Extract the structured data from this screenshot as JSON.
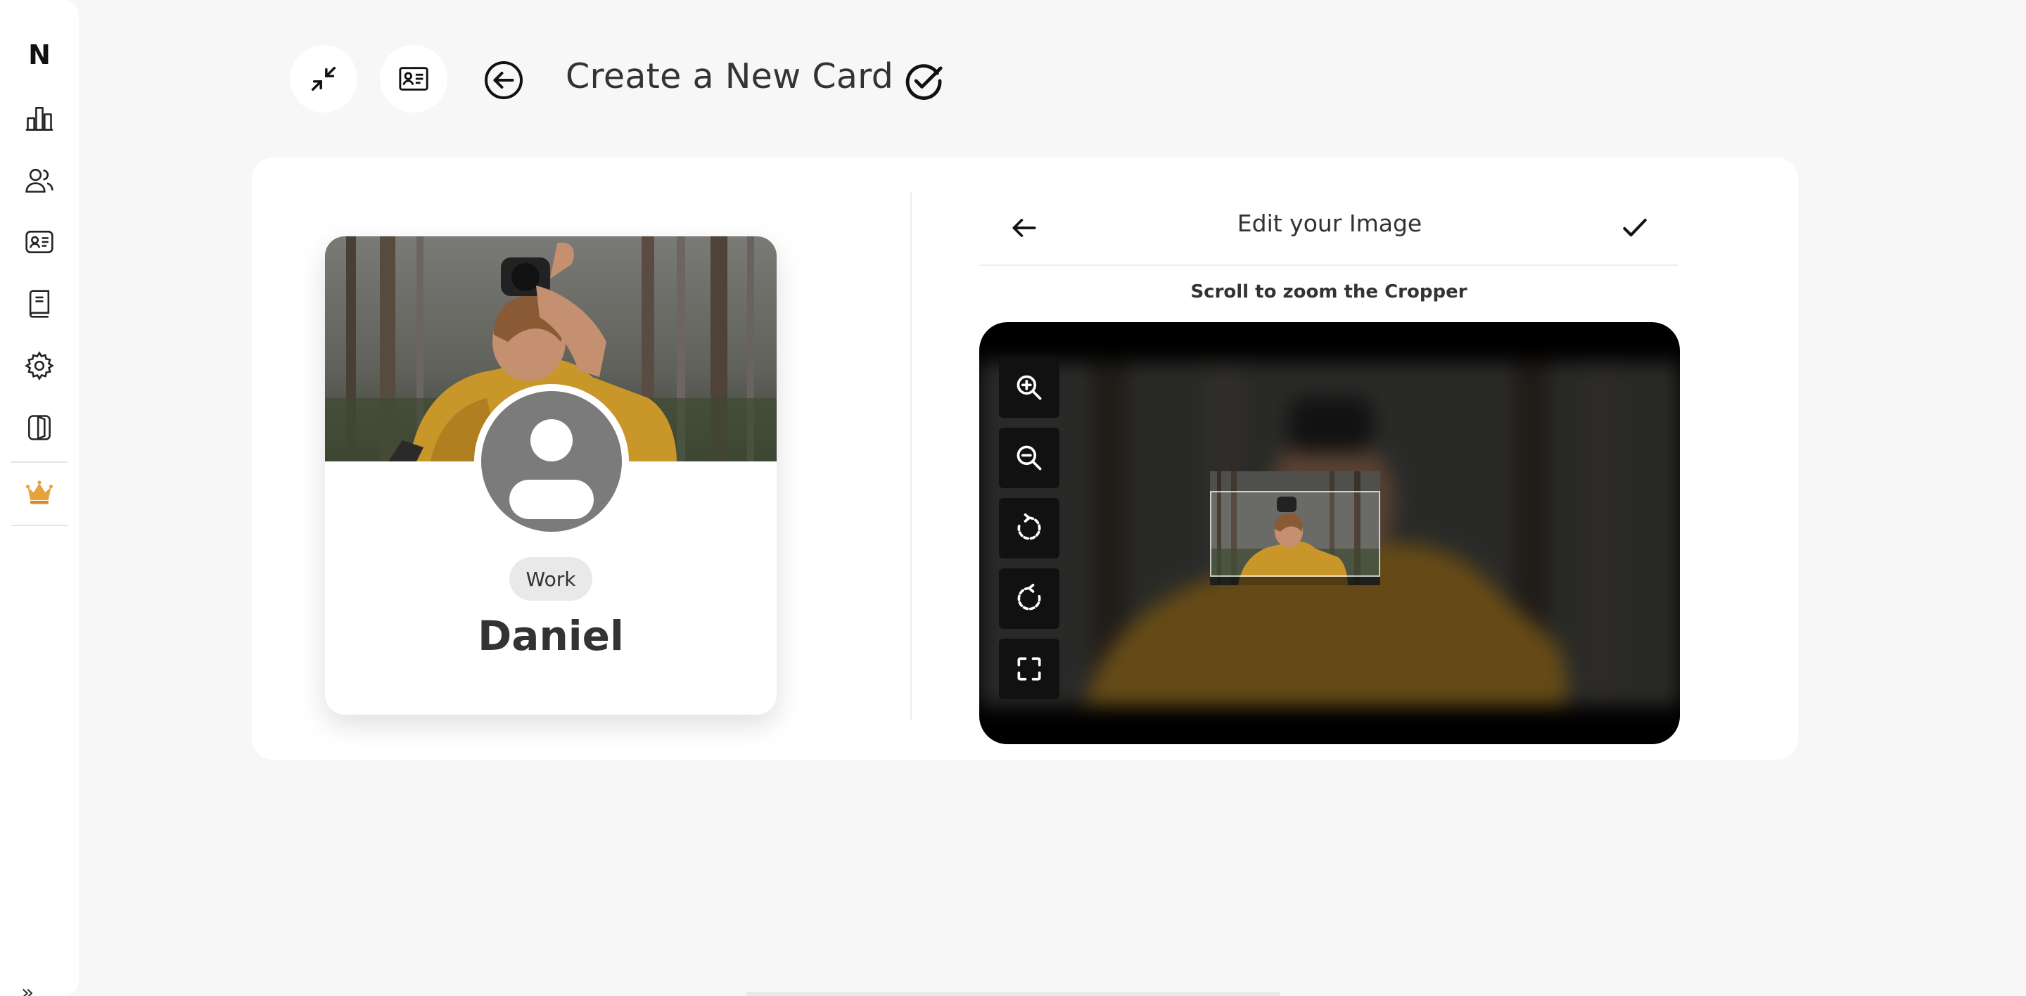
{
  "sidebar": {
    "logo": "N",
    "items": [
      {
        "icon": "bar-chart-icon"
      },
      {
        "icon": "users-icon"
      },
      {
        "icon": "contact-card-icon"
      },
      {
        "icon": "book-icon"
      },
      {
        "icon": "gear-icon"
      },
      {
        "icon": "door-icon"
      },
      {
        "icon": "crown-icon"
      }
    ],
    "expand_glyph": "»"
  },
  "header": {
    "title": "Create a New Card",
    "buttons": [
      {
        "icon": "minimize-arrows-icon"
      },
      {
        "icon": "id-card-icon"
      },
      {
        "icon": "back-circle-icon"
      },
      {
        "icon": "check-circle-icon"
      }
    ]
  },
  "card": {
    "tag": "Work",
    "name": "Daniel"
  },
  "editor": {
    "title": "Edit your Image",
    "hint": "Scroll to zoom the Cropper",
    "tools": [
      {
        "icon": "zoom-in-icon"
      },
      {
        "icon": "zoom-out-icon"
      },
      {
        "icon": "rotate-right-icon"
      },
      {
        "icon": "rotate-left-icon"
      },
      {
        "icon": "fit-frame-icon"
      }
    ]
  },
  "colors": {
    "accent_crown": "#e8a23a",
    "jacket": "#c9962a",
    "forest": "#5a5c55",
    "avatar_gray": "#7b7b7b"
  }
}
